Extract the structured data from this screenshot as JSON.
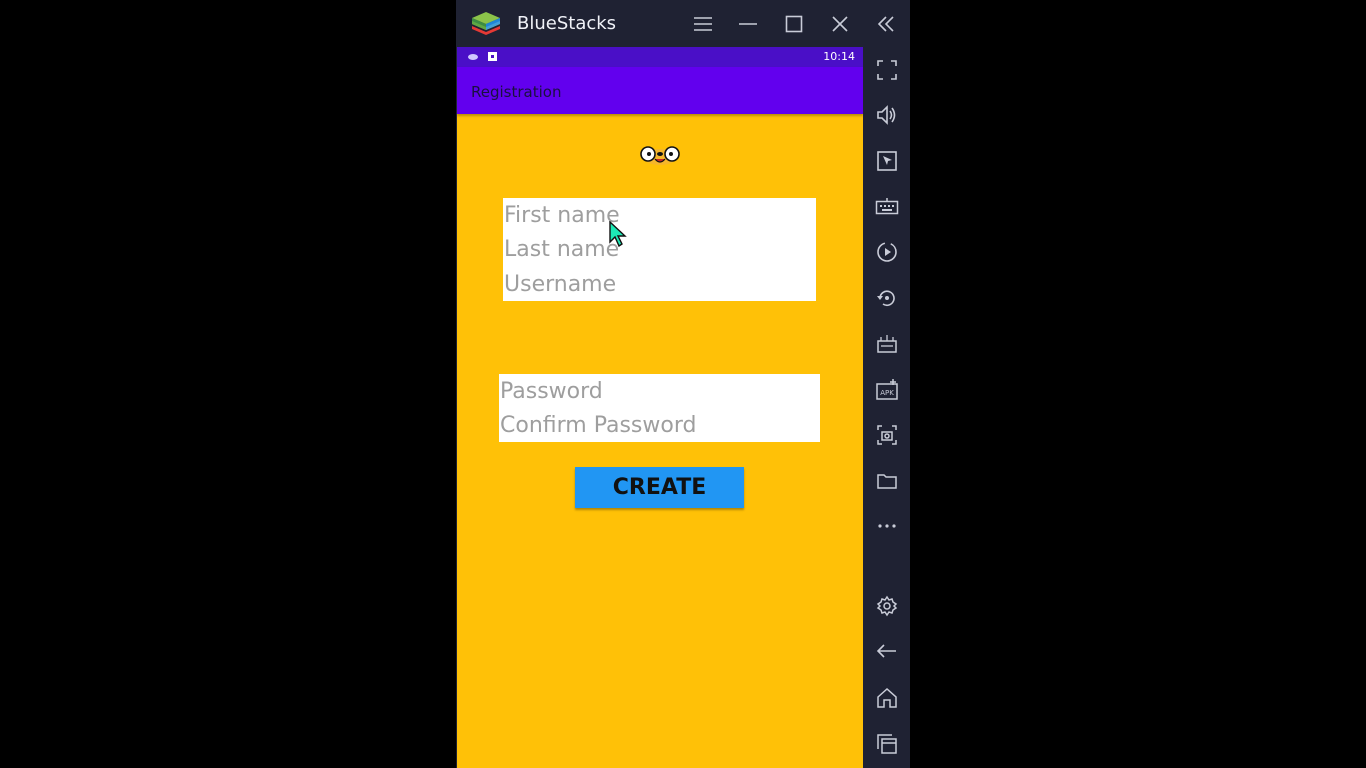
{
  "window": {
    "title": "BlueStacks",
    "icons": [
      "bluestacks-logo",
      "hamburger-menu-icon",
      "minimize-icon",
      "maximize-icon",
      "close-icon",
      "collapse-sidebar-icon"
    ]
  },
  "status_bar": {
    "time": "10:14",
    "icons": [
      "notification-icon",
      "app-notification-icon"
    ]
  },
  "app_bar": {
    "title": "Registration"
  },
  "form": {
    "mascot_icon": "dog-face-icon",
    "first_name": {
      "placeholder": "First name",
      "value": ""
    },
    "last_name": {
      "placeholder": "Last name",
      "value": ""
    },
    "username": {
      "placeholder": "Username",
      "value": ""
    },
    "password": {
      "placeholder": "Password",
      "value": ""
    },
    "confirm_password": {
      "placeholder": "Confirm Password",
      "value": ""
    },
    "create_label": "CREATE"
  },
  "colors": {
    "background": "#ffc107",
    "app_bar": "#6200ee",
    "status_bar": "#4a0fc7",
    "button": "#2196f3",
    "chrome": "#1f2233"
  },
  "sidebar_tools": [
    "fullscreen-icon",
    "volume-icon",
    "pointer-icon",
    "keyboard-icon",
    "macro-record-icon",
    "rotate-icon",
    "multi-instance-icon",
    "install-apk-icon",
    "screenshot-icon",
    "folder-icon",
    "more-icon",
    "settings-icon",
    "back-icon",
    "home-icon",
    "recent-apps-icon"
  ]
}
